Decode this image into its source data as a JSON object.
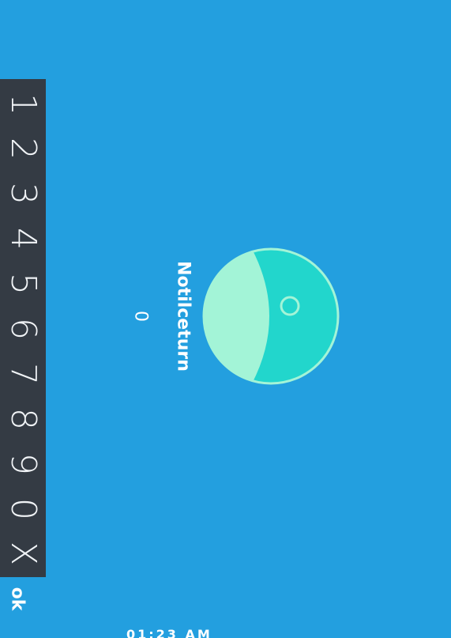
{
  "app": {
    "name": "Notilceturn",
    "counter_value": "0",
    "bottom_text": "01:23 AM"
  },
  "keypad": {
    "keys": [
      "1",
      "2",
      "3",
      "4",
      "5",
      "6",
      "7",
      "8",
      "9",
      "0",
      "X"
    ],
    "ok_label": "ok"
  },
  "colors": {
    "background": "#239fdf",
    "keypad_background": "#343b44",
    "logo_light": "#a3f4d7",
    "logo_dark": "#22d6cc",
    "text": "#ffffff"
  }
}
